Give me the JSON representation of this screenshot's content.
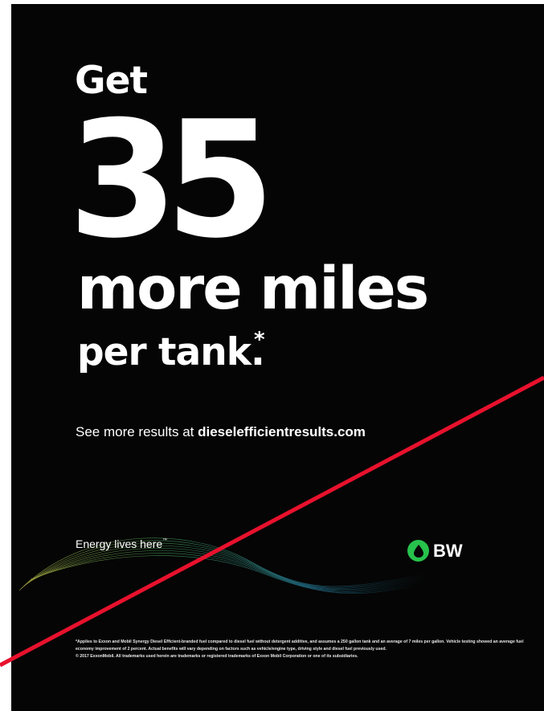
{
  "headline": {
    "get": "Get",
    "number": "35",
    "more_miles": "more miles",
    "per_tank": "per tank.",
    "asterisk": "*"
  },
  "results": {
    "prefix": "See more results at ",
    "url": "dieselefficientresults.com"
  },
  "tagline": {
    "text": "Energy lives here",
    "trademark": "™"
  },
  "logo": {
    "text": "BW",
    "color": "#27c24c",
    "icon": "drop-icon"
  },
  "disclaimer": {
    "line1": "*Applies to Exxon and Mobil Synergy Diesel Efficient-branded fuel compared to diesel fuel without detergent additive, and assumes a 250 gallon tank and an average of 7 miles per gallon. Vehicle testing showed an average fuel economy improvement of 2 percent. Actual benefits will vary depending on factors such as vehicle/engine type, driving style and diesel fuel previously used.",
    "line2": "© 2017 ExxonMobil. All trademarks used herein are trademarks or registered trademarks of Exxon Mobil Corporation or one of its subsidiaries."
  },
  "colors": {
    "background": "#050505",
    "accent_line": "#e8112d",
    "text": "#ffffff"
  }
}
